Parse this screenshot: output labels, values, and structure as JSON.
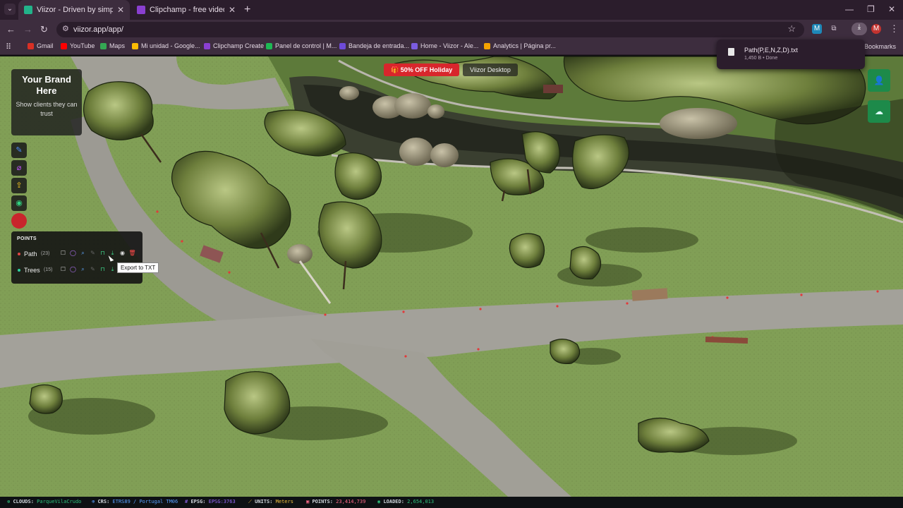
{
  "browser": {
    "tabs": [
      {
        "title": "Viizor - Driven by simplicity",
        "favicon_color": "#22b38a"
      },
      {
        "title": "Clipchamp - free video editor &",
        "favicon_color": "#8a3fd1"
      }
    ],
    "url": "viizor.app/app/",
    "bookmarks": [
      {
        "label": "Gmail",
        "color": "#d93025"
      },
      {
        "label": "YouTube",
        "color": "#ff0000"
      },
      {
        "label": "Maps",
        "color": "#34a853"
      },
      {
        "label": "Mi unidad - Google...",
        "color": "#fbbc04"
      },
      {
        "label": "Clipchamp Create",
        "color": "#8a3fd1"
      },
      {
        "label": "Panel de control | M...",
        "color": "#1db954"
      },
      {
        "label": "Bandeja de entrada...",
        "color": "#6e4bd8"
      },
      {
        "label": "Home - Viizor - Ale...",
        "color": "#7b5ce0"
      },
      {
        "label": "Analytics | Página pr...",
        "color": "#f4a300"
      }
    ],
    "bookmarks_folder": "Bookmarks",
    "download": {
      "filename": "Path(P,E,N,Z,D).txt",
      "meta": "1,450 B • Done"
    },
    "profile_initial": "M"
  },
  "promo": {
    "holiday": "50% OFF Holiday",
    "desktop": "Viizor Desktop"
  },
  "brand": {
    "title": "Your Brand Here",
    "subtitle": "Show clients they can trust"
  },
  "points_panel": {
    "header": "POINTS",
    "layers": [
      {
        "name": "Path",
        "count": "(23)",
        "color": "#e04545"
      },
      {
        "name": "Trees",
        "count": "(15)",
        "color": "#2ed0a0"
      }
    ]
  },
  "tooltip": "Export to TXT",
  "statusbar": {
    "clouds": {
      "key": "CLOUDS:",
      "value": "ParqueVilaCrudo"
    },
    "crs": {
      "key": "CRS:",
      "value": "ETRS89 / Portugal TM06"
    },
    "epsg": {
      "key": "EPSG:",
      "value": "EPSG:3763"
    },
    "units": {
      "key": "UNITS:",
      "value": "Meters"
    },
    "points": {
      "key": "POINTS:",
      "value": "23,414,739"
    },
    "loaded": {
      "key": "LOADED:",
      "value": "2,654,013"
    }
  }
}
